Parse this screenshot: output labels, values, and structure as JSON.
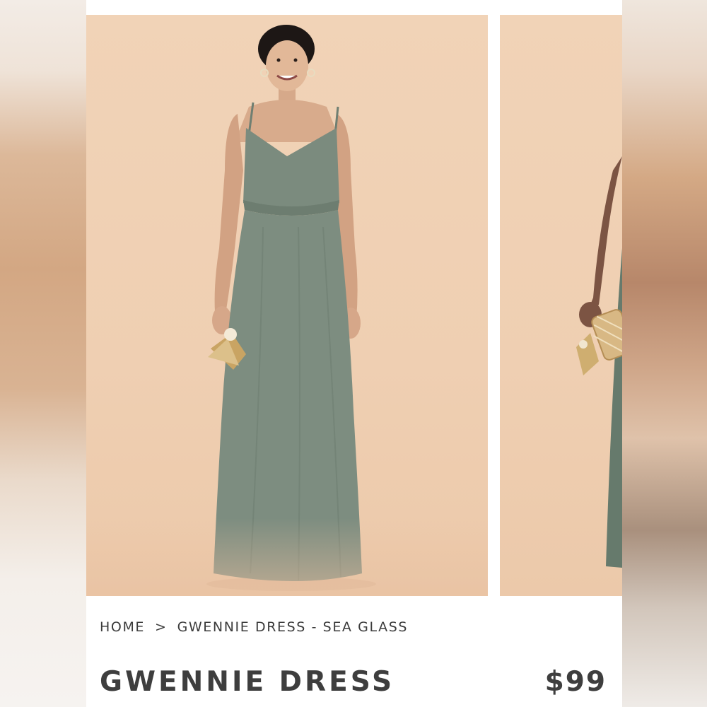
{
  "breadcrumb": {
    "home": "HOME",
    "separator": ">",
    "current": "GWENNIE DRESS - SEA GLASS"
  },
  "product": {
    "name": "GWENNIE DRESS",
    "price": "$99"
  },
  "gallery": {
    "images": [
      {
        "name": "main-product-photo"
      },
      {
        "name": "next-product-photo"
      }
    ]
  },
  "colors": {
    "backdrop": "#f0d2b5",
    "dress": "#7a8a7d",
    "text": "#3e3e3e"
  }
}
